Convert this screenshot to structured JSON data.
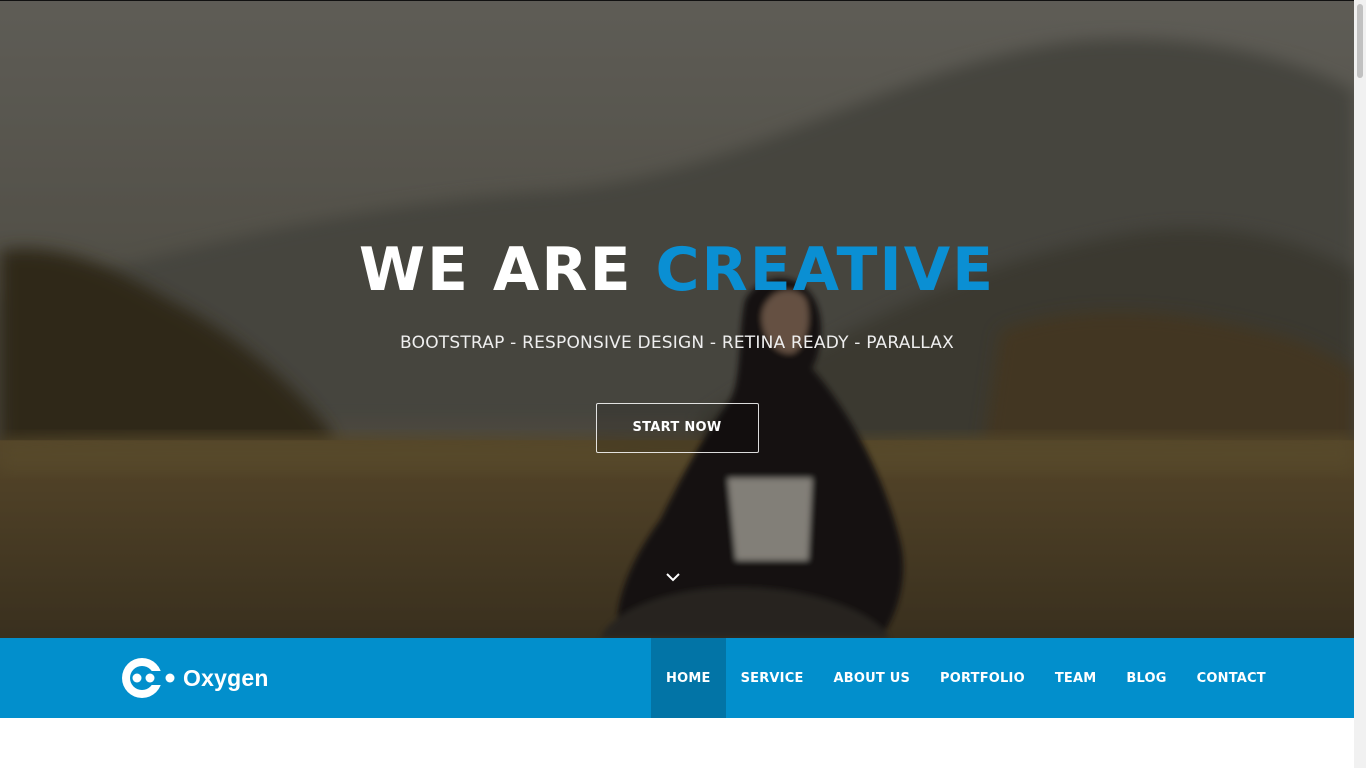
{
  "hero": {
    "title_prefix": "WE ARE",
    "title_accent": "CREATIVE",
    "subtitle": "BOOTSTRAP - RESPONSIVE DESIGN - RETINA READY - PARALLAX",
    "button_label": "START NOW",
    "scroll_icon": "chevron-down-icon"
  },
  "navbar": {
    "brand_name": "Oxygen",
    "brand_icon": "oxygen-logo",
    "items": [
      {
        "label": "HOME",
        "active": true
      },
      {
        "label": "SERVICE",
        "active": false
      },
      {
        "label": "ABOUT US",
        "active": false
      },
      {
        "label": "PORTFOLIO",
        "active": false
      },
      {
        "label": "TEAM",
        "active": false
      },
      {
        "label": "BLOG",
        "active": false
      },
      {
        "label": "CONTACT",
        "active": false
      }
    ]
  },
  "colors": {
    "accent": "#0a8fd3",
    "navbar_bg": "#028fcc",
    "nav_active_bg": "#0274a6",
    "hero_text": "#ffffff"
  }
}
